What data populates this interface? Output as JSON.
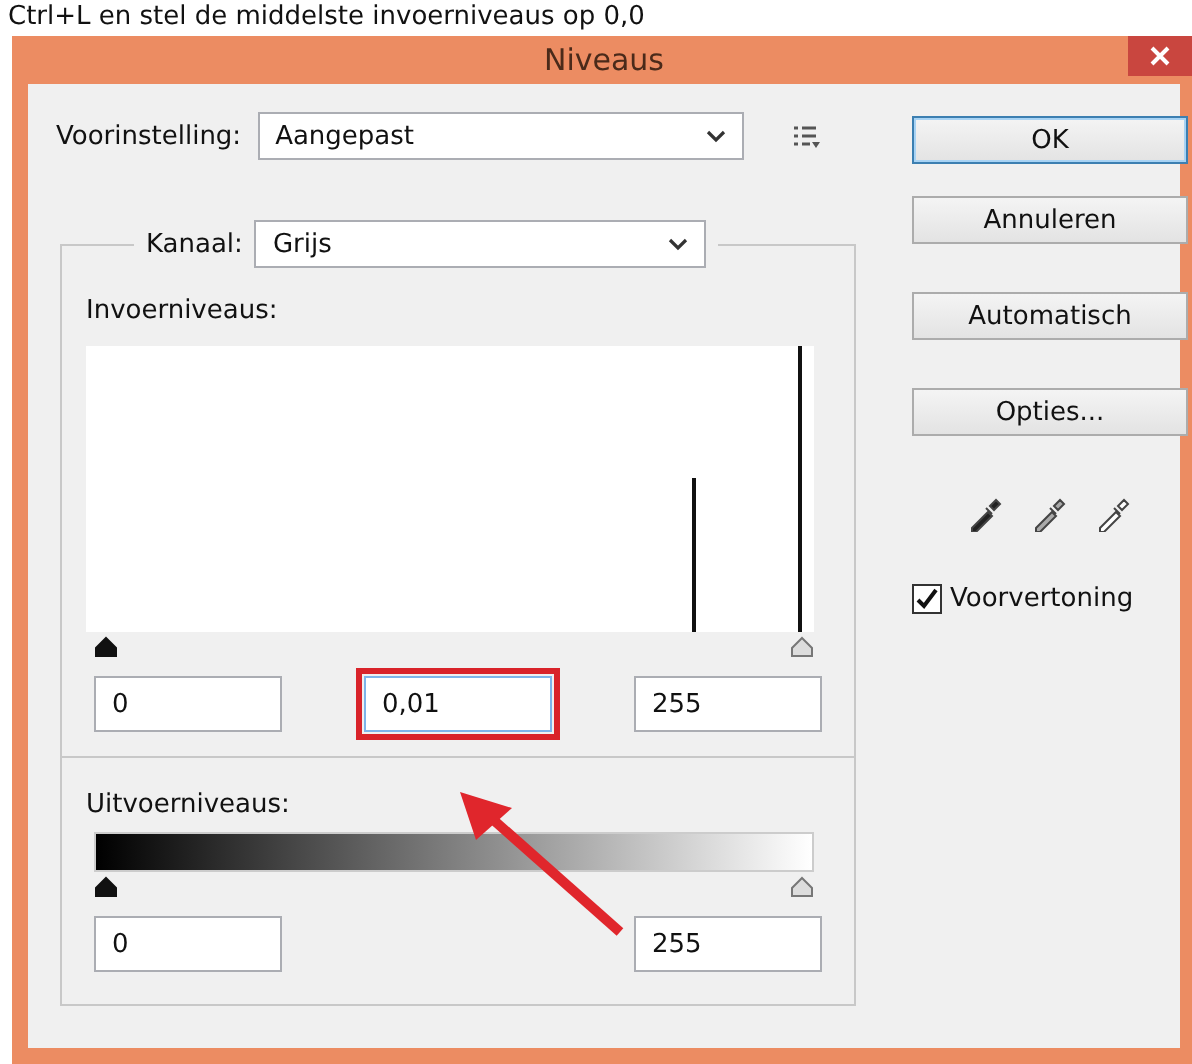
{
  "caption": "Ctrl+L en stel de middelste invoerniveaus op 0,0",
  "window": {
    "title": "Niveaus"
  },
  "preset": {
    "label": "Voorinstelling:",
    "value": "Aangepast"
  },
  "channel": {
    "label": "Kanaal:",
    "value": "Grijs"
  },
  "input_levels": {
    "label": "Invoerniveaus:",
    "fields": [
      {
        "value": "0",
        "highlighted": false
      },
      {
        "value": "0,01",
        "highlighted": true
      },
      {
        "value": "255",
        "highlighted": false
      }
    ]
  },
  "output_levels": {
    "label": "Uitvoerniveaus:",
    "fields": [
      {
        "value": "0"
      },
      {
        "value": "255"
      }
    ]
  },
  "buttons": [
    {
      "label": "OK",
      "default": true
    },
    {
      "label": "Annuleren",
      "default": false
    },
    {
      "label": "Automatisch",
      "default": false
    },
    {
      "label": "Opties...",
      "default": false
    }
  ],
  "preview": {
    "label": "Voorvertoning",
    "checked": true
  }
}
